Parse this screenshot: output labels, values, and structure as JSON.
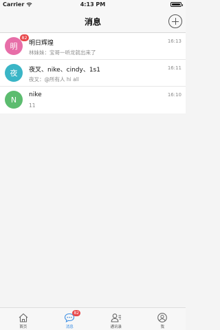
{
  "status_bar": {
    "carrier": "Carrier",
    "time": "4:13 PM"
  },
  "nav": {
    "title": "消息"
  },
  "conversations": [
    {
      "avatar_char": "明",
      "avatar_color": "#e76ea8",
      "badge": "82",
      "name": "明日辉煌",
      "preview": "林妹妹：宝哥一听龙就出来了",
      "time": "16:13"
    },
    {
      "avatar_char": "夜",
      "avatar_color": "#3ab5c6",
      "badge": "",
      "name": "夜叉、nike、cindy、1s1",
      "preview": "夜叉：@所有人  hi all",
      "time": "16:11"
    },
    {
      "avatar_char": "N",
      "avatar_color": "#5cbc6f",
      "badge": "",
      "name": "nike",
      "preview": "11",
      "time": "16:10"
    }
  ],
  "tabs": [
    {
      "label": "首页",
      "icon": "home-icon"
    },
    {
      "label": "消息",
      "icon": "chat-icon",
      "badge": "82"
    },
    {
      "label": "通讯录",
      "icon": "contacts-icon"
    },
    {
      "label": "我",
      "icon": "profile-icon"
    }
  ],
  "colors": {
    "accent": "#3c8ee3",
    "badge": "#e8474a"
  }
}
